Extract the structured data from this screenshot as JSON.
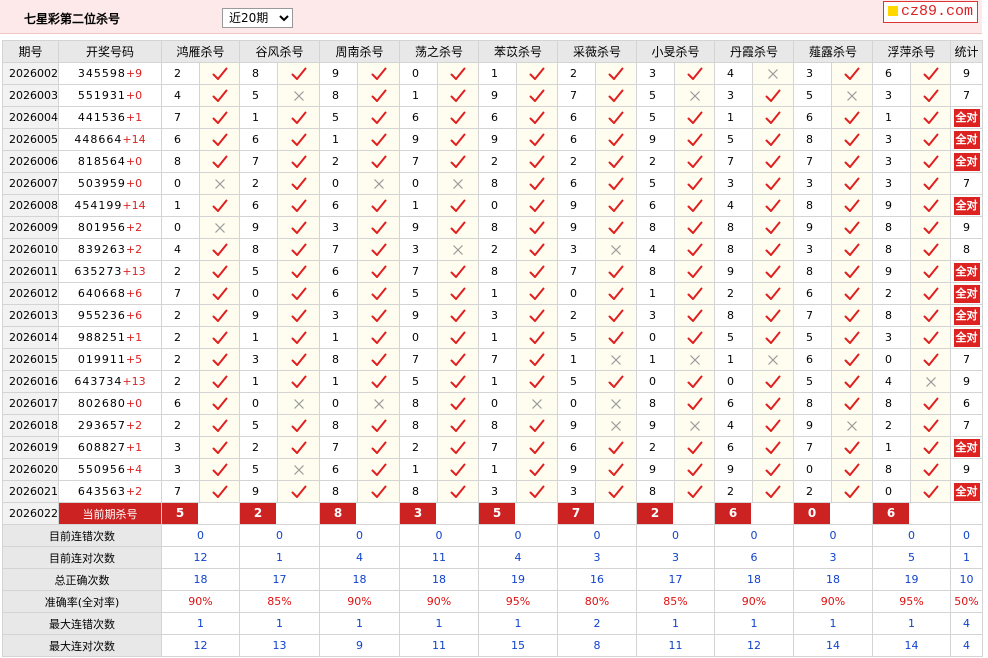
{
  "header": {
    "title": "七星彩第二位杀号",
    "period_select": {
      "selected": "近20期"
    },
    "logo": "cz89.com"
  },
  "columns": {
    "period": "期号",
    "number": "开奖号码",
    "experts": [
      "鸿雁杀号",
      "谷风杀号",
      "周南杀号",
      "荡之杀号",
      "苯苡杀号",
      "采薇杀号",
      "小旻杀号",
      "丹霞杀号",
      "薤露杀号",
      "浮萍杀号"
    ],
    "stats": "统计"
  },
  "rows": [
    {
      "period": "2026002",
      "number": "345598",
      "add": "+9",
      "kills": [
        2,
        8,
        9,
        0,
        1,
        2,
        3,
        4,
        3,
        6
      ],
      "ok": [
        1,
        1,
        1,
        1,
        1,
        1,
        1,
        0,
        1,
        1
      ],
      "stat": "9"
    },
    {
      "period": "2026003",
      "number": "551931",
      "add": "+0",
      "kills": [
        4,
        5,
        8,
        1,
        9,
        7,
        5,
        3,
        5,
        3
      ],
      "ok": [
        1,
        0,
        1,
        1,
        1,
        1,
        0,
        1,
        0,
        1
      ],
      "stat": "7"
    },
    {
      "period": "2026004",
      "number": "441536",
      "add": "+1",
      "kills": [
        7,
        1,
        5,
        6,
        6,
        6,
        5,
        1,
        6,
        1
      ],
      "ok": [
        1,
        1,
        1,
        1,
        1,
        1,
        1,
        1,
        1,
        1
      ],
      "stat": "全对"
    },
    {
      "period": "2026005",
      "number": "448664",
      "add": "+14",
      "kills": [
        6,
        6,
        1,
        9,
        9,
        6,
        9,
        5,
        8,
        3
      ],
      "ok": [
        1,
        1,
        1,
        1,
        1,
        1,
        1,
        1,
        1,
        1
      ],
      "stat": "全对"
    },
    {
      "period": "2026006",
      "number": "818564",
      "add": "+0",
      "kills": [
        8,
        7,
        2,
        7,
        2,
        2,
        2,
        7,
        7,
        3
      ],
      "ok": [
        1,
        1,
        1,
        1,
        1,
        1,
        1,
        1,
        1,
        1
      ],
      "stat": "全对"
    },
    {
      "period": "2026007",
      "number": "503959",
      "add": "+0",
      "kills": [
        0,
        2,
        0,
        0,
        8,
        6,
        5,
        3,
        3,
        3
      ],
      "ok": [
        0,
        1,
        0,
        0,
        1,
        1,
        1,
        1,
        1,
        1
      ],
      "stat": "7"
    },
    {
      "period": "2026008",
      "number": "454199",
      "add": "+14",
      "kills": [
        1,
        6,
        6,
        1,
        0,
        9,
        6,
        4,
        8,
        9
      ],
      "ok": [
        1,
        1,
        1,
        1,
        1,
        1,
        1,
        1,
        1,
        1
      ],
      "stat": "全对"
    },
    {
      "period": "2026009",
      "number": "801956",
      "add": "+2",
      "kills": [
        0,
        9,
        3,
        9,
        8,
        9,
        8,
        8,
        9,
        8
      ],
      "ok": [
        0,
        1,
        1,
        1,
        1,
        1,
        1,
        1,
        1,
        1
      ],
      "stat": "9"
    },
    {
      "period": "2026010",
      "number": "839263",
      "add": "+2",
      "kills": [
        4,
        8,
        7,
        3,
        2,
        3,
        4,
        8,
        3,
        8
      ],
      "ok": [
        1,
        1,
        1,
        0,
        1,
        0,
        1,
        1,
        1,
        1
      ],
      "stat": "8"
    },
    {
      "period": "2026011",
      "number": "635273",
      "add": "+13",
      "kills": [
        2,
        5,
        6,
        7,
        8,
        7,
        8,
        9,
        8,
        9
      ],
      "ok": [
        1,
        1,
        1,
        1,
        1,
        1,
        1,
        1,
        1,
        1
      ],
      "stat": "全对"
    },
    {
      "period": "2026012",
      "number": "640668",
      "add": "+6",
      "kills": [
        7,
        0,
        6,
        5,
        1,
        0,
        1,
        2,
        6,
        2
      ],
      "ok": [
        1,
        1,
        1,
        1,
        1,
        1,
        1,
        1,
        1,
        1
      ],
      "stat": "全对"
    },
    {
      "period": "2026013",
      "number": "955236",
      "add": "+6",
      "kills": [
        2,
        9,
        3,
        9,
        3,
        2,
        3,
        8,
        7,
        8
      ],
      "ok": [
        1,
        1,
        1,
        1,
        1,
        1,
        1,
        1,
        1,
        1
      ],
      "stat": "全对"
    },
    {
      "period": "2026014",
      "number": "988251",
      "add": "+1",
      "kills": [
        2,
        1,
        1,
        0,
        1,
        5,
        0,
        5,
        5,
        3
      ],
      "ok": [
        1,
        1,
        1,
        1,
        1,
        1,
        1,
        1,
        1,
        1
      ],
      "stat": "全对"
    },
    {
      "period": "2026015",
      "number": "019911",
      "add": "+5",
      "kills": [
        2,
        3,
        8,
        7,
        7,
        1,
        1,
        1,
        6,
        0
      ],
      "ok": [
        1,
        1,
        1,
        1,
        1,
        0,
        0,
        0,
        1,
        1
      ],
      "stat": "7"
    },
    {
      "period": "2026016",
      "number": "643734",
      "add": "+13",
      "kills": [
        2,
        1,
        1,
        5,
        1,
        5,
        0,
        0,
        5,
        4
      ],
      "ok": [
        1,
        1,
        1,
        1,
        1,
        1,
        1,
        1,
        1,
        0
      ],
      "stat": "9"
    },
    {
      "period": "2026017",
      "number": "802680",
      "add": "+0",
      "kills": [
        6,
        0,
        0,
        8,
        0,
        0,
        8,
        6,
        8,
        8
      ],
      "ok": [
        1,
        0,
        0,
        1,
        0,
        0,
        1,
        1,
        1,
        1
      ],
      "stat": "6"
    },
    {
      "period": "2026018",
      "number": "293657",
      "add": "+2",
      "kills": [
        2,
        5,
        8,
        8,
        8,
        9,
        9,
        4,
        9,
        2
      ],
      "ok": [
        1,
        1,
        1,
        1,
        1,
        0,
        0,
        1,
        0,
        1
      ],
      "stat": "7"
    },
    {
      "period": "2026019",
      "number": "608827",
      "add": "+1",
      "kills": [
        3,
        2,
        7,
        2,
        7,
        6,
        2,
        6,
        7,
        1
      ],
      "ok": [
        1,
        1,
        1,
        1,
        1,
        1,
        1,
        1,
        1,
        1
      ],
      "stat": "全对"
    },
    {
      "period": "2026020",
      "number": "550956",
      "add": "+4",
      "kills": [
        3,
        5,
        6,
        1,
        1,
        9,
        9,
        9,
        0,
        8
      ],
      "ok": [
        1,
        0,
        1,
        1,
        1,
        1,
        1,
        1,
        1,
        1
      ],
      "stat": "9"
    },
    {
      "period": "2026021",
      "number": "643563",
      "add": "+2",
      "kills": [
        7,
        9,
        8,
        8,
        3,
        3,
        8,
        2,
        2,
        0
      ],
      "ok": [
        1,
        1,
        1,
        1,
        1,
        1,
        1,
        1,
        1,
        1
      ],
      "stat": "全对"
    }
  ],
  "current": {
    "period": "2026022",
    "label": "当前期杀号",
    "kills": [
      "5",
      "2",
      "8",
      "3",
      "5",
      "7",
      "2",
      "6",
      "0",
      "6"
    ]
  },
  "stats": [
    {
      "label": "目前连错次数",
      "values": [
        "0",
        "0",
        "0",
        "0",
        "0",
        "0",
        "0",
        "0",
        "0",
        "0",
        "0"
      ],
      "red": false
    },
    {
      "label": "目前连对次数",
      "values": [
        "12",
        "1",
        "4",
        "11",
        "4",
        "3",
        "3",
        "6",
        "3",
        "5",
        "1"
      ],
      "red": false
    },
    {
      "label": "总正确次数",
      "values": [
        "18",
        "17",
        "18",
        "18",
        "19",
        "16",
        "17",
        "18",
        "18",
        "19",
        "10"
      ],
      "red": false
    },
    {
      "label": "准确率(全对率)",
      "values": [
        "90%",
        "85%",
        "90%",
        "90%",
        "95%",
        "80%",
        "85%",
        "90%",
        "90%",
        "95%",
        "50%"
      ],
      "red": true
    },
    {
      "label": "最大连错次数",
      "values": [
        "1",
        "1",
        "1",
        "1",
        "1",
        "2",
        "1",
        "1",
        "1",
        "1",
        "4"
      ],
      "red": false
    },
    {
      "label": "最大连对次数",
      "values": [
        "12",
        "13",
        "9",
        "11",
        "15",
        "8",
        "11",
        "12",
        "14",
        "14",
        "4"
      ],
      "red": false
    }
  ],
  "colors": {
    "right": "#e02020",
    "wrong": "#999999",
    "accent": "#cc2222",
    "stat_blue": "#1144cc"
  }
}
